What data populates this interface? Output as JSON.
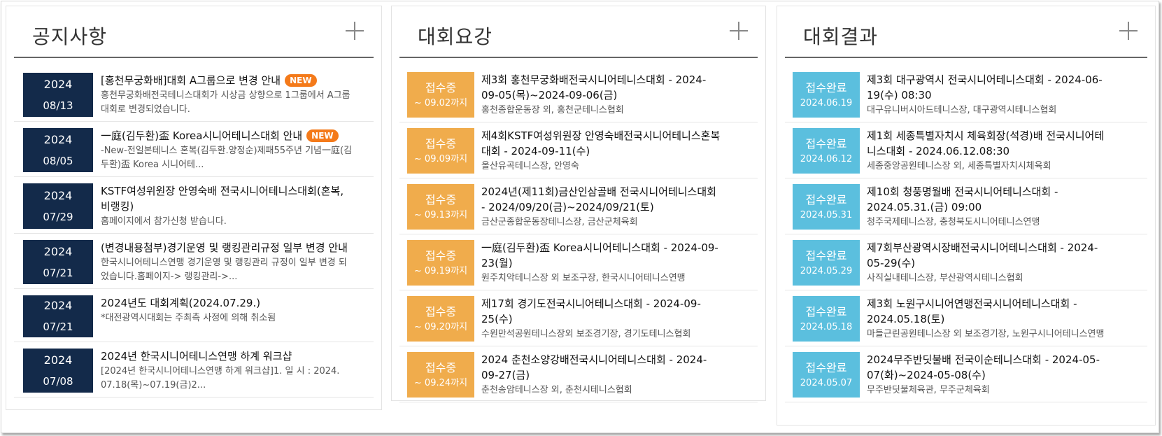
{
  "notices": {
    "title": "공지사항",
    "items": [
      {
        "year": "2024",
        "date": "08/13",
        "title": "[홍천무궁화배]대회 A그룹으로 변경 안내",
        "new": "NEW",
        "desc": "홍천무궁화배전국테니스대회가 시상금 상향으로 1그룹에서 A그룹대회로 변경되었습니다."
      },
      {
        "year": "2024",
        "date": "08/05",
        "title": "一庭(김두환)盃 Korea시니어테니스대회 안내",
        "new": "NEW",
        "desc": "-New-전일본테니스 혼복(김두환.양정순)제패55주년 기념一庭(김두환)盃 Korea 시니어테..."
      },
      {
        "year": "2024",
        "date": "07/29",
        "title": "KSTF여성위원장 안영숙배 전국시니어테니스대회(혼복, 비랭킹)",
        "new": "",
        "desc": "홈페이지에서 참가신청 받습니다."
      },
      {
        "year": "2024",
        "date": "07/21",
        "title": "(변경내용첨부)경기운영 및 랭킹관리규정 일부 변경 안내",
        "new": "",
        "desc": "한국시니어테니스연맹 경기운영 및 랭킹관리 규정이 일부 변경 되었습니다.홈페이지-> 랭킹관리->..."
      },
      {
        "year": "2024",
        "date": "07/21",
        "title": "2024년도 대회계획(2024.07.29.)",
        "new": "",
        "desc": "*대전광역시대회는 주최측 사정에 의해 취소됨"
      },
      {
        "year": "2024",
        "date": "07/08",
        "title": "2024년 한국시니어테니스연맹 하계 워크샵",
        "new": "",
        "desc": "[2024년 한국시니어테니스연맹 하계 워크샵]1. 일 시 : 2024. 07.18(목)~07.19(금)2..."
      }
    ]
  },
  "guidelines": {
    "title": "대회요강",
    "items": [
      {
        "status": "접수중",
        "deadline": "~ 09.02까지",
        "title": "제3회 홍천무궁화배전국시니어테니스대회 - 2024-09-05(목)~2024-09-06(금)",
        "place": "홍천종합운동장 외, 홍천군테니스협회"
      },
      {
        "status": "접수중",
        "deadline": "~ 09.09까지",
        "title": "제4회KSTF여성위원장 안영숙배전국시니어테니스혼복대회 - 2024-09-11(수)",
        "place": "올산유곡테니스장, 안영숙"
      },
      {
        "status": "접수중",
        "deadline": "~ 09.13까지",
        "title": "2024년(제11회)금산인삼골배 전국시니어테니스대회 - 2024/09/20(금)~2024/09/21(토)",
        "place": "금산군종합운동장테니스장, 금산군체육회"
      },
      {
        "status": "접수중",
        "deadline": "~ 09.19까지",
        "title": "一庭(김두환)盃 Korea시니어테니스대회 - 2024-09-23(월)",
        "place": "원주치악테니스장 외 보조구장, 한국시니어테니스연맹"
      },
      {
        "status": "접수중",
        "deadline": "~ 09.20까지",
        "title": "제17회 경기도전국시니어테니스대회 - 2024-09-25(수)",
        "place": "수원만석공원테니스장외 보조경기장, 경기도테니스협회"
      },
      {
        "status": "접수중",
        "deadline": "~ 09.24까지",
        "title": "2024 춘천소양강배전국시니어테니스대회 - 2024-09-27(금)",
        "place": "춘천송암테니스장 외, 춘천시테니스협회"
      }
    ]
  },
  "results": {
    "title": "대회결과",
    "items": [
      {
        "status": "접수완료",
        "date": "2024.06.19",
        "title": "제3회 대구광역시 전국시니어테니스대회 - 2024-06-19(수) 08:30",
        "place": "대구유니버시아드테니스장, 대구광역시테니스협회"
      },
      {
        "status": "접수완료",
        "date": "2024.06.12",
        "title": "제1회 세종특별자치시 체육회장(석경)배 전국시니어테니스대회 - 2024.06.12.08:30",
        "place": "세종중앙공원테니스장 외, 세종특별자치시체육회"
      },
      {
        "status": "접수완료",
        "date": "2024.05.31",
        "title": "제10회 청풍명월배 전국시니어테니스대회 - 2024.05.31.(금) 09:00",
        "place": "청주국제테니스장, 충청북도시니어테니스연맹"
      },
      {
        "status": "접수완료",
        "date": "2024.05.29",
        "title": "제7회부산광역시장배전국시니어테니스대회 - 2024-05-29(수)",
        "place": "사직실내테니스장, 부산광역시테니스협회"
      },
      {
        "status": "접수완료",
        "date": "2024.05.18",
        "title": "제3회 노원구시니어연맹전국시니어테니스대회 - 2024.05.18(토)",
        "place": "마들근린공원테니스장 외 보조경기장, 노원구시니어테니스연맹"
      },
      {
        "status": "접수완료",
        "date": "2024.05.07",
        "title": "2024무주반딧불배 전국이순테니스대회 - 2024-05-07(화)~2024-05-08(수)",
        "place": "무주반딧불체육관, 무주군체육회"
      }
    ]
  }
}
